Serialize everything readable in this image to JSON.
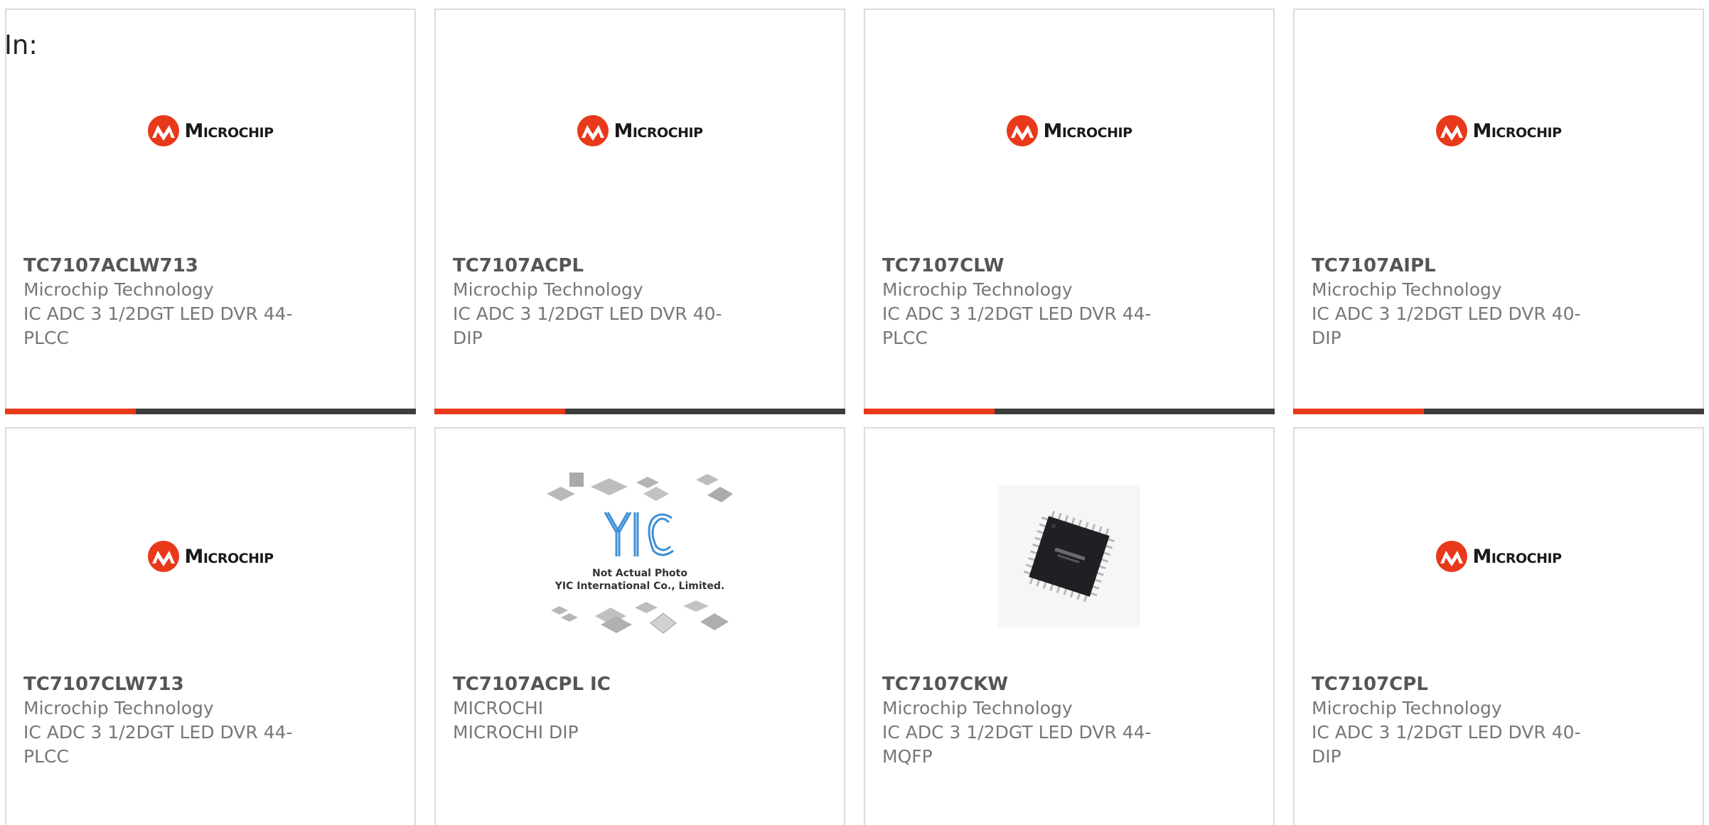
{
  "page": {
    "in_label": "In:"
  },
  "brand": {
    "logo_text": "Microchip",
    "accent_color": "#e8391a",
    "bar_color": "#3d3d3d"
  },
  "products": [
    {
      "part": "TC7107ACLW713",
      "manufacturer": "Microchip Technology",
      "description": "IC ADC 3 1/2DGT LED DVR 44-PLCC",
      "image": "microchip-logo"
    },
    {
      "part": "TC7107ACPL",
      "manufacturer": "Microchip Technology",
      "description": "IC ADC 3 1/2DGT LED DVR 40-DIP",
      "image": "microchip-logo"
    },
    {
      "part": "TC7107CLW",
      "manufacturer": "Microchip Technology",
      "description": "IC ADC 3 1/2DGT LED DVR 44-PLCC",
      "image": "microchip-logo"
    },
    {
      "part": "TC7107AIPL",
      "manufacturer": "Microchip Technology",
      "description": "IC ADC 3 1/2DGT LED DVR 40-DIP",
      "image": "microchip-logo"
    },
    {
      "part": "TC7107CLW713",
      "manufacturer": "Microchip Technology",
      "description": "IC ADC 3 1/2DGT LED DVR 44-PLCC",
      "image": "microchip-logo"
    },
    {
      "part": "TC7107ACPL IC",
      "manufacturer": "MICROCHI",
      "description": "MICROCHI DIP",
      "image": "yic-placeholder",
      "placeholder_line1": "Not Actual Photo",
      "placeholder_line2": "YIC International Co., Limited."
    },
    {
      "part": "TC7107CKW",
      "manufacturer": "Microchip Technology",
      "description": "IC ADC 3 1/2DGT LED DVR 44-MQFP",
      "image": "qfp-chip-photo"
    },
    {
      "part": "TC7107CPL",
      "manufacturer": "Microchip Technology",
      "description": "IC ADC 3 1/2DGT LED DVR 40-DIP",
      "image": "microchip-logo"
    }
  ]
}
